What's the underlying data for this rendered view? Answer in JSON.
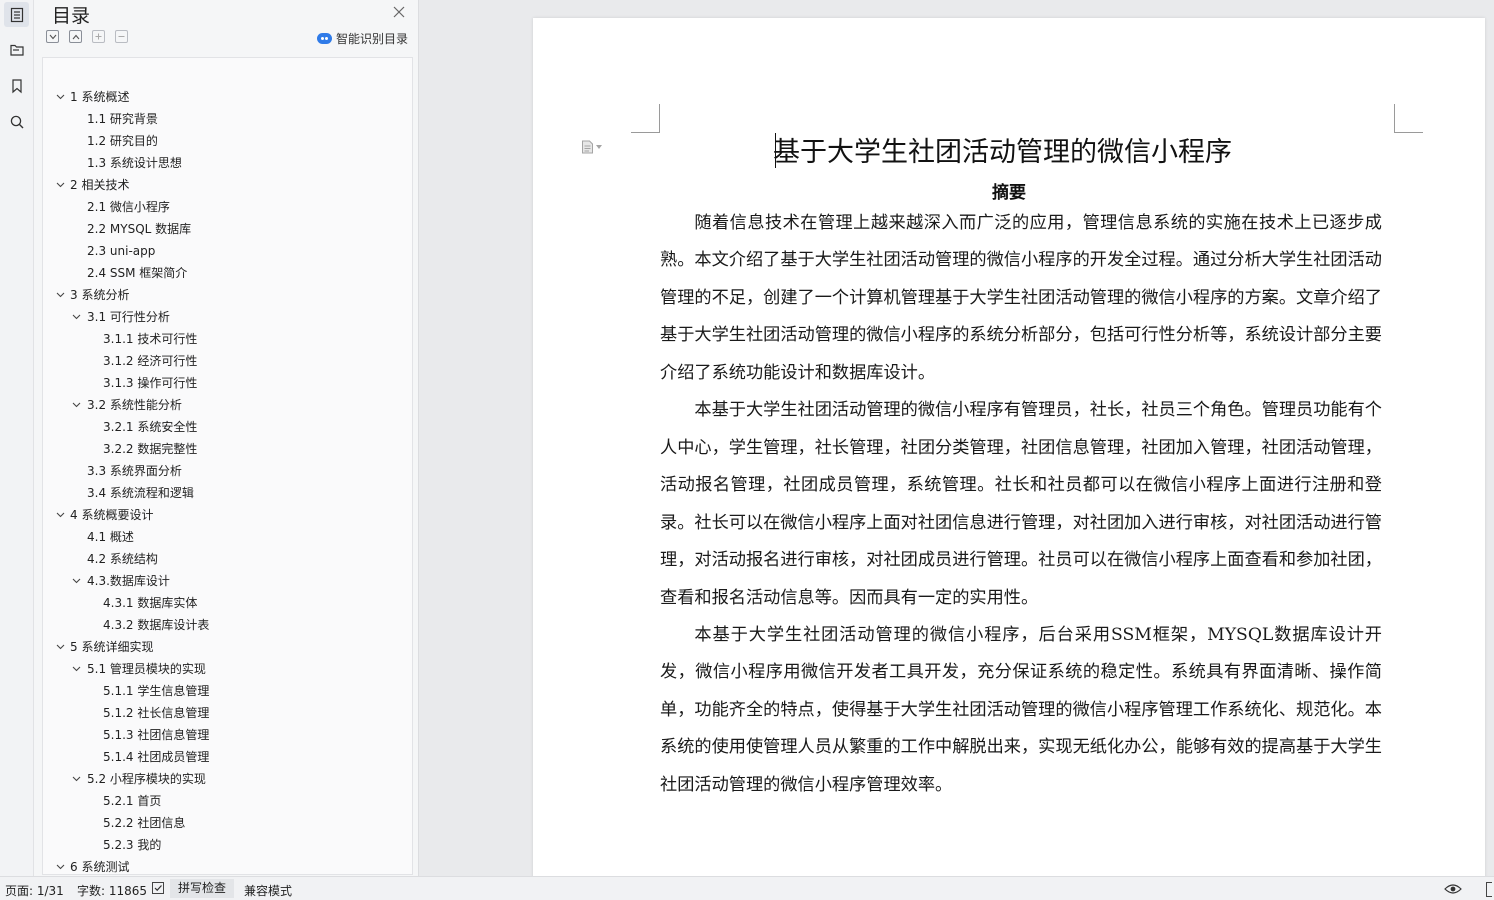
{
  "sidebar_rail": {
    "icons": [
      "toc-icon",
      "folder-tree-icon",
      "bookmark-icon",
      "search-icon"
    ]
  },
  "toc": {
    "title": "目录",
    "smart_label": "智能识别目录",
    "items": [
      {
        "label": "1 系统概述",
        "level": 1,
        "expanded": true
      },
      {
        "label": "1.1  研究背景",
        "level": 2
      },
      {
        "label": "1.2 研究目的",
        "level": 2
      },
      {
        "label": "1.3 系统设计思想",
        "level": 2
      },
      {
        "label": "2 相关技术",
        "level": 1,
        "expanded": true
      },
      {
        "label": "2.1 微信小程序",
        "level": 2
      },
      {
        "label": "2.2 MYSQL 数据库",
        "level": 2
      },
      {
        "label": "2.3 uni-app",
        "level": 2
      },
      {
        "label": "2.4 SSM 框架简介",
        "level": 2
      },
      {
        "label": "3 系统分析",
        "level": 1,
        "expanded": true
      },
      {
        "label": "3.1 可行性分析",
        "level": 2,
        "expanded": true
      },
      {
        "label": "3.1.1 技术可行性",
        "level": 3
      },
      {
        "label": "3.1.2 经济可行性",
        "level": 3
      },
      {
        "label": "3.1.3 操作可行性",
        "level": 3
      },
      {
        "label": "3.2 系统性能分析",
        "level": 2,
        "expanded": true
      },
      {
        "label": "3.2.1  系统安全性",
        "level": 3
      },
      {
        "label": "3.2.2  数据完整性",
        "level": 3
      },
      {
        "label": "3.3 系统界面分析",
        "level": 2
      },
      {
        "label": "3.4 系统流程和逻辑",
        "level": 2
      },
      {
        "label": "4 系统概要设计",
        "level": 1,
        "expanded": true
      },
      {
        "label": "4.1 概述",
        "level": 2
      },
      {
        "label": "4.2 系统结构",
        "level": 2
      },
      {
        "label": "4.3.数据库设计",
        "level": 2,
        "expanded": true
      },
      {
        "label": "4.3.1 数据库实体",
        "level": 3
      },
      {
        "label": "4.3.2 数据库设计表",
        "level": 3
      },
      {
        "label": "5 系统详细实现",
        "level": 1,
        "expanded": true
      },
      {
        "label": "5.1  管理员模块的实现",
        "level": 2,
        "expanded": true
      },
      {
        "label": "5.1.1  学生信息管理",
        "level": 3
      },
      {
        "label": "5.1.2  社长信息管理",
        "level": 3
      },
      {
        "label": "5.1.3  社团信息管理",
        "level": 3
      },
      {
        "label": "5.1.4  社团成员管理",
        "level": 3
      },
      {
        "label": "5.2  小程序模块的实现",
        "level": 2,
        "expanded": true
      },
      {
        "label": "5.2.1  首页",
        "level": 3
      },
      {
        "label": "5.2.2  社团信息",
        "level": 3
      },
      {
        "label": "5.2.3  我的",
        "level": 3
      },
      {
        "label": "6 系统测试",
        "level": 1,
        "expanded": true
      }
    ]
  },
  "document": {
    "title": "基于大学生社团活动管理的微信小程序",
    "abstract_heading": "摘要",
    "paragraphs": [
      "随着信息技术在管理上越来越深入而广泛的应用，管理信息系统的实施在技术上已逐步成熟。本文介绍了基于大学生社团活动管理的微信小程序的开发全过程。通过分析大学生社团活动管理的不足，创建了一个计算机管理基于大学生社团活动管理的微信小程序的方案。文章介绍了基于大学生社团活动管理的微信小程序的系统分析部分，包括可行性分析等，系统设计部分主要介绍了系统功能设计和数据库设计。",
      "本基于大学生社团活动管理的微信小程序有管理员，社长，社员三个角色。管理员功能有个人中心，学生管理，社长管理，社团分类管理，社团信息管理，社团加入管理，社团活动管理，活动报名管理，社团成员管理，系统管理。社长和社员都可以在微信小程序上面进行注册和登录。社长可以在微信小程序上面对社团信息进行管理，对社团加入进行审核，对社团活动进行管理，对活动报名进行审核，对社团成员进行管理。社员可以在微信小程序上面查看和参加社团，查看和报名活动信息等。因而具有一定的实用性。",
      "本基于大学生社团活动管理的微信小程序，后台采用SSM框架，MYSQL数据库设计开发，微信小程序用微信开发者工具开发，充分保证系统的稳定性。系统具有界面清晰、操作简单，功能齐全的特点，使得基于大学生社团活动管理的微信小程序管理工作系统化、规范化。本系统的使用使管理人员从繁重的工作中解脱出来，实现无纸化办公，能够有效的提高基于大学生社团活动管理的微信小程序管理效率。"
    ]
  },
  "status_bar": {
    "page": "页面: 1/31",
    "word_count": "字数: 11865",
    "spell_check": "拼写检查",
    "compat_mode": "兼容模式"
  },
  "colors": {
    "accent": "#2f7be8",
    "panel_bg": "#f5f6f7",
    "canvas_bg": "#e9eaec"
  }
}
